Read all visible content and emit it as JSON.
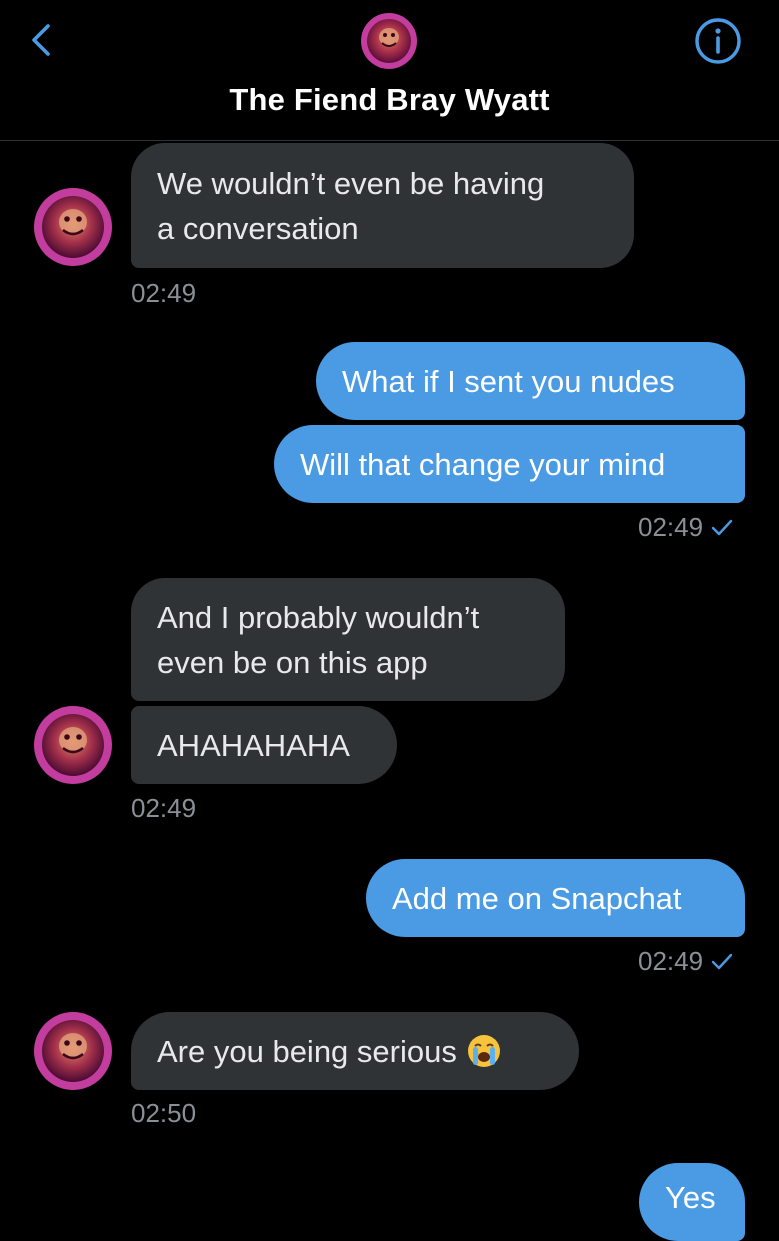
{
  "header": {
    "title": "The Fiend Bray Wyatt",
    "back_icon": "chevron-left-icon",
    "info_icon": "info-icon",
    "accent_color": "#4a9ae4"
  },
  "messages": [
    {
      "direction": "incoming",
      "text_lines": [
        "We wouldn’t even be having",
        "a conversation"
      ]
    },
    {
      "direction": "incoming_time",
      "time": "02:49"
    },
    {
      "direction": "outgoing",
      "text": "What if I sent you nudes"
    },
    {
      "direction": "outgoing",
      "text": "Will that change your mind"
    },
    {
      "direction": "outgoing_time",
      "time": "02:49"
    },
    {
      "direction": "incoming",
      "text_lines": [
        "And I probably wouldn’t",
        "even be on this app"
      ]
    },
    {
      "direction": "incoming",
      "text": "AHAHAHAHA"
    },
    {
      "direction": "incoming_time",
      "time": "02:49"
    },
    {
      "direction": "outgoing",
      "text": "Add me on Snapchat"
    },
    {
      "direction": "outgoing_time",
      "time": "02:49"
    },
    {
      "direction": "incoming",
      "text": "Are you being serious",
      "emoji": "loudly-crying-face-emoji"
    },
    {
      "direction": "incoming_time",
      "time": "02:50"
    },
    {
      "direction": "outgoing",
      "text": "Yes"
    }
  ],
  "colors": {
    "incoming_bubble": "#2f3336",
    "outgoing_bubble": "#4a9ae4",
    "timestamp": "#8b9097"
  }
}
